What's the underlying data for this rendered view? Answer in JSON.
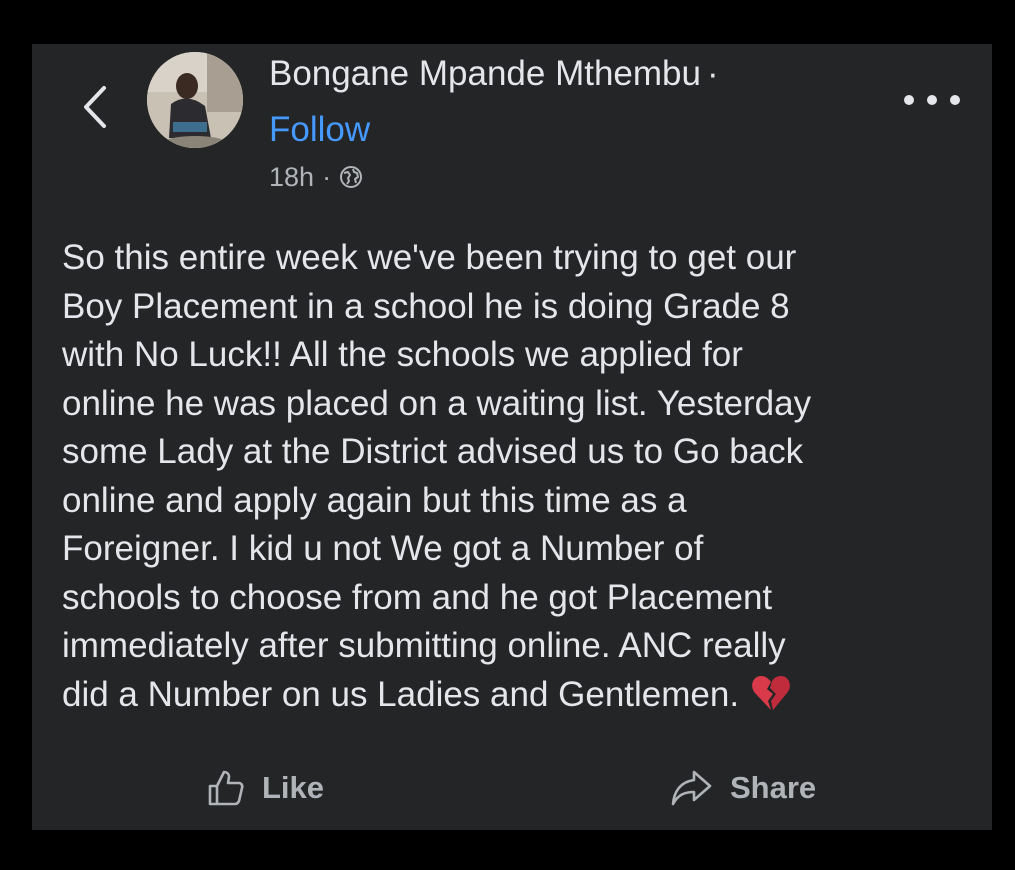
{
  "post": {
    "author": "Bongane Mpande Mthembu",
    "author_separator": "·",
    "follow_label": "Follow",
    "timestamp": "18h",
    "meta_separator": "·",
    "privacy_icon": "globe-icon",
    "body_lines": [
      "So this entire week we've been trying to get our",
      "Boy Placement in a school he is doing Grade 8",
      "with No Luck!! All the schools we applied for",
      "online he was placed on a waiting list. Yesterday",
      "some Lady at the District advised us to Go back",
      "online and apply again but this time as a",
      "Foreigner. I kid u not We got a Number of",
      "schools to choose from and he got Placement",
      "immediately after submitting online. ANC really",
      "did a Number on us Ladies and Gentlemen."
    ],
    "trailing_emoji": "broken-heart-icon"
  },
  "actions": {
    "like_label": "Like",
    "share_label": "Share"
  },
  "colors": {
    "background": "#242526",
    "text": "#e4e6eb",
    "link": "#4599ff",
    "muted": "#b0b3b8",
    "emoji_red": "#d83a4a"
  }
}
